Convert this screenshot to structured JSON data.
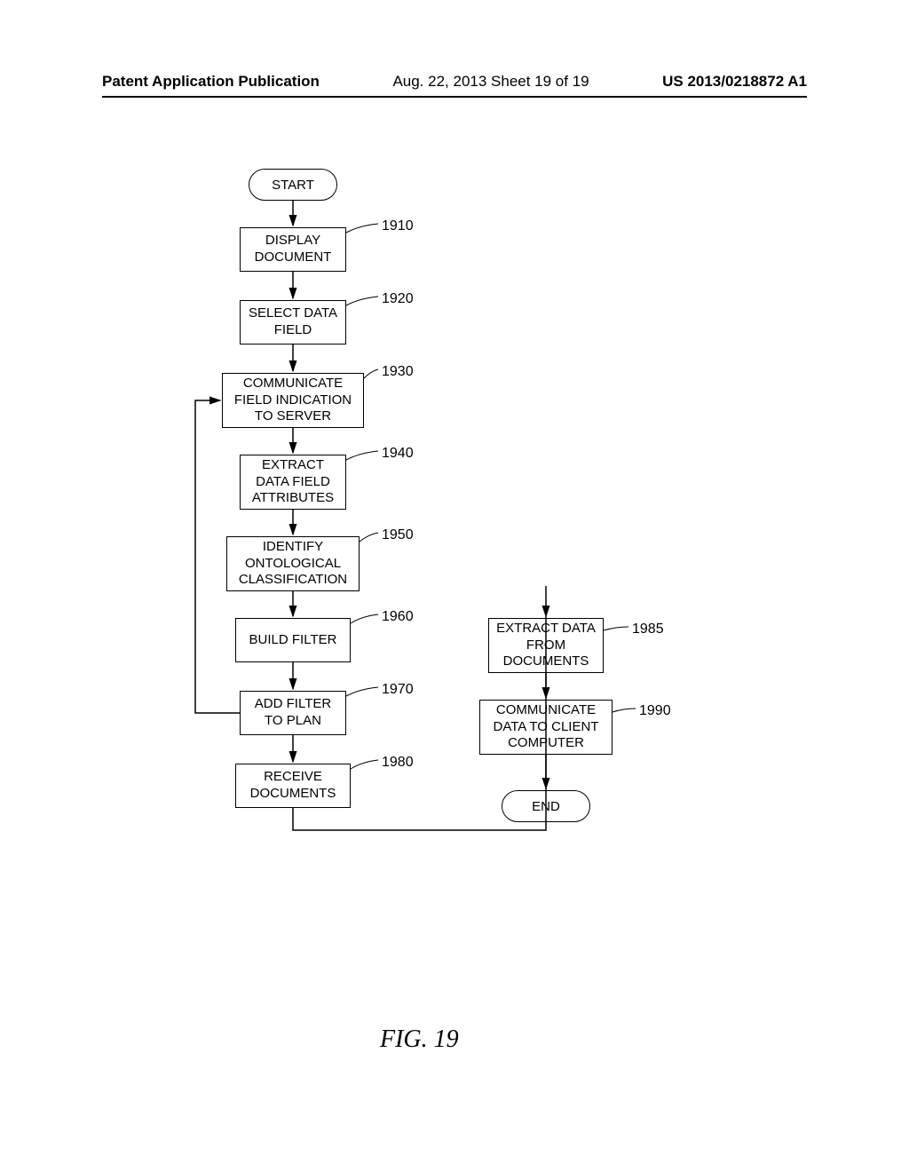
{
  "header": {
    "left": "Patent Application Publication",
    "mid": "Aug. 22, 2013  Sheet 19 of 19",
    "right": "US 2013/0218872 A1"
  },
  "diagram": {
    "start": "START",
    "end": "END",
    "steps": {
      "s1910": {
        "label": "DISPLAY DOCUMENT",
        "ref": "1910"
      },
      "s1920": {
        "label": "SELECT DATA FIELD",
        "ref": "1920"
      },
      "s1930": {
        "label": "COMMUNICATE FIELD INDICATION TO SERVER",
        "ref": "1930"
      },
      "s1940": {
        "label": "EXTRACT DATA FIELD ATTRIBUTES",
        "ref": "1940"
      },
      "s1950": {
        "label": "IDENTIFY ONTOLOGICAL CLASSIFICATION",
        "ref": "1950"
      },
      "s1960": {
        "label": "BUILD FILTER",
        "ref": "1960"
      },
      "s1970": {
        "label": "ADD FILTER TO PLAN",
        "ref": "1970"
      },
      "s1980": {
        "label": "RECEIVE DOCUMENTS",
        "ref": "1980"
      },
      "s1985": {
        "label": "EXTRACT DATA FROM DOCUMENTS",
        "ref": "1985"
      },
      "s1990": {
        "label": "COMMUNICATE DATA TO CLIENT COMPUTER",
        "ref": "1990"
      }
    },
    "figure_label": "FIG.  19"
  }
}
